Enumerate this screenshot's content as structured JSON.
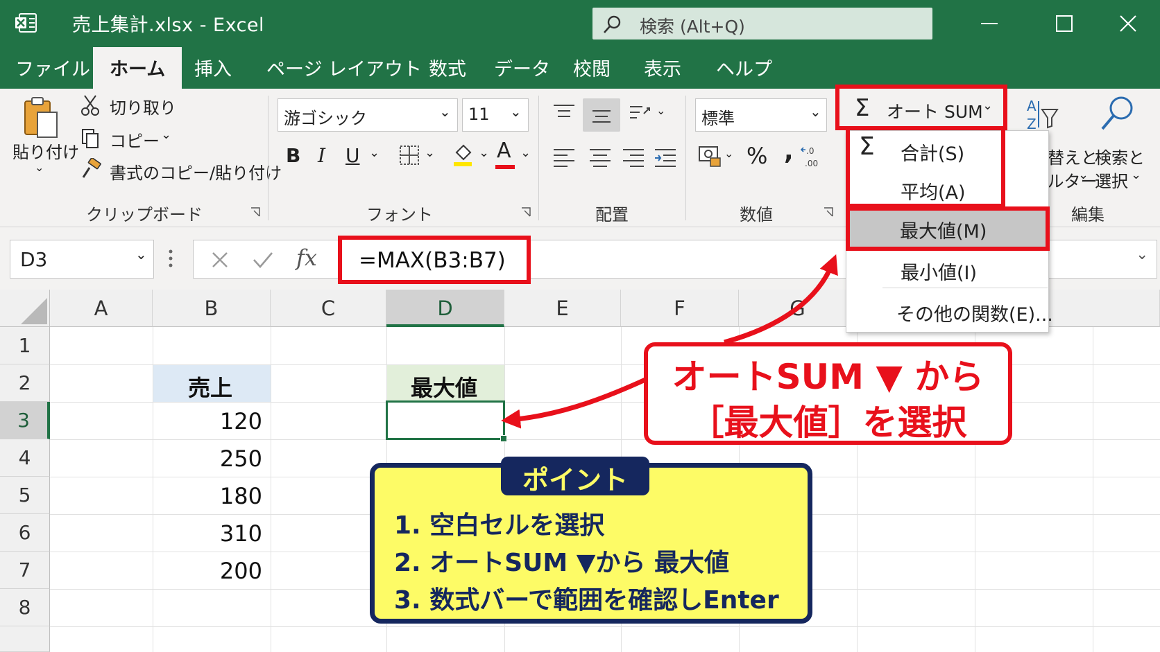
{
  "window": {
    "title": "売上集計.xlsx  -  Excel",
    "search_placeholder": "検索 (Alt+Q)"
  },
  "tabs": [
    "ファイル",
    "ホーム",
    "挿入",
    "ページ レイアウト",
    "数式",
    "データ",
    "校閲",
    "表示",
    "ヘルプ"
  ],
  "active_tab": "ホーム",
  "ribbon": {
    "clipboard": {
      "paste": "貼り付け",
      "cut": "切り取り",
      "copy": "コピー",
      "format_painter": "書式のコピー/貼り付け",
      "group": "クリップボード"
    },
    "font": {
      "name": "游ゴシック",
      "size": "11",
      "group": "フォント",
      "bold": "B",
      "italic": "I",
      "underline": "U",
      "font_color_letter": "A",
      "font_color": "#e8101b",
      "highlight_color": "#ffe600"
    },
    "alignment": {
      "group": "配置"
    },
    "number": {
      "format": "標準",
      "percent": "%",
      "comma": ",",
      "group": "数値"
    },
    "editing": {
      "autosum": "オート SUM",
      "sort_filter_line1": "並べ替えと",
      "sort_filter_line2": "フィルター",
      "find_select_line1": "検索と",
      "find_select_line2": "選択",
      "group": "編集"
    }
  },
  "autosum_menu": {
    "items": [
      {
        "label": "合計(S)",
        "icon": "sigma-icon"
      },
      {
        "label": "平均(A)"
      },
      {
        "label": "最大値(M)",
        "highlighted": true
      },
      {
        "label": "最小値(I)"
      },
      {
        "label": "その他の関数(E)..."
      }
    ]
  },
  "formula_bar": {
    "name_box": "D3",
    "fx": "fx",
    "formula": "=MAX(B3:B7)"
  },
  "sheet": {
    "columns": [
      "A",
      "B",
      "C",
      "D",
      "E",
      "F",
      "G"
    ],
    "rows": [
      "1",
      "2",
      "3",
      "4",
      "5",
      "6",
      "7",
      "8"
    ],
    "selected_cell": "D3",
    "b2_header": "売上",
    "d2_header": "最大値",
    "b_values": [
      "120",
      "250",
      "180",
      "310",
      "200"
    ]
  },
  "callout": {
    "line1": "オートSUM ▼ から",
    "line2": "［最大値］を選択",
    "color": "#e8101b"
  },
  "point_box": {
    "badge": "ポイント",
    "steps": [
      "1.  空白セルを選択",
      "2.  オートSUM ▼から 最大値",
      "3.  数式バーで範囲を確認しEnter"
    ]
  },
  "colors": {
    "excel_green": "#217346",
    "highlight_red": "#e8101b",
    "header_blue": "#dde9f5",
    "header_green": "#e2efda",
    "point_yellow": "#fdfb66",
    "point_navy": "#15275e"
  }
}
